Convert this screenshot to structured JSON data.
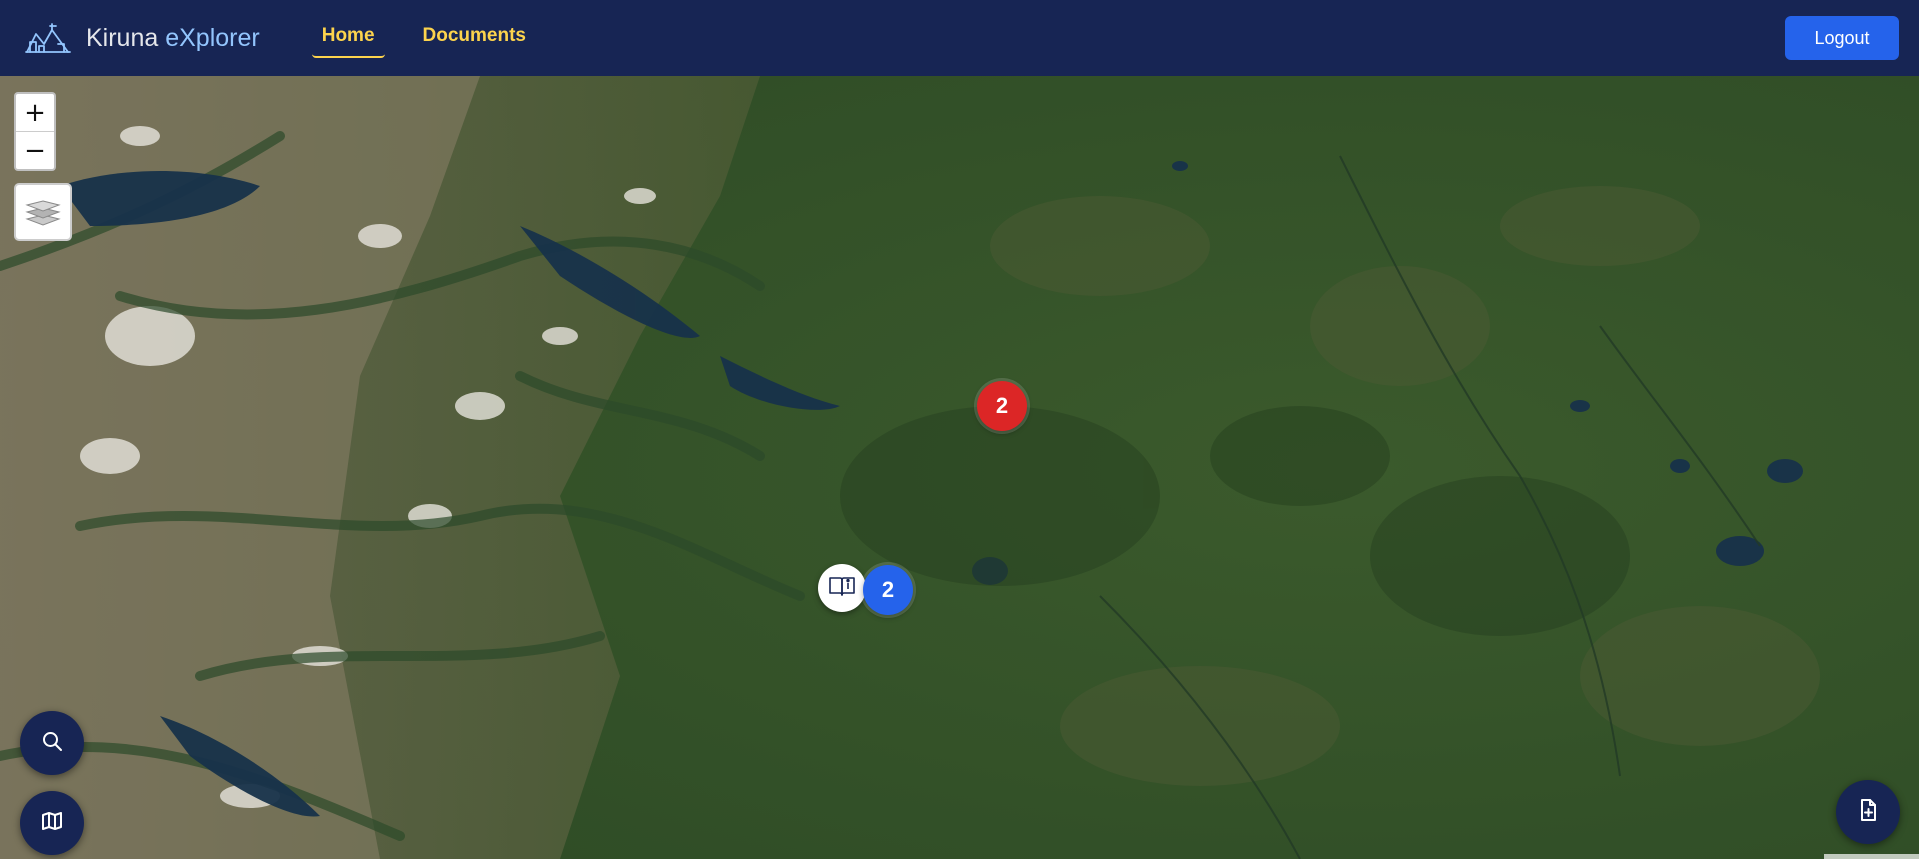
{
  "app": {
    "title_main": "Kiruna ",
    "title_accent": "eXplorer"
  },
  "nav": {
    "items": [
      {
        "label": "Home",
        "active": true
      },
      {
        "label": "Documents",
        "active": false
      }
    ],
    "logout_label": "Logout"
  },
  "map": {
    "basemap": "satellite",
    "zoom_in_label": "+",
    "zoom_out_label": "−",
    "layers_icon": "layers-icon",
    "clusters": [
      {
        "count": "2",
        "color": "#dc2626"
      },
      {
        "count": "2",
        "color": "#2563eb"
      }
    ],
    "document_marker_icon": "book-info-icon"
  },
  "controls": {
    "search_icon": "search-icon",
    "map_icon": "map-icon",
    "add_document_icon": "file-plus-icon"
  },
  "colors": {
    "navbar": "#172554",
    "nav_active": "#fcd34d",
    "brand_accent": "#93c5fd",
    "logout": "#2563eb"
  }
}
